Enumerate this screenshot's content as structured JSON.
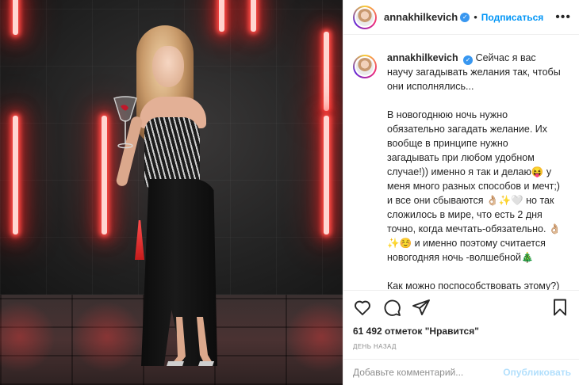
{
  "post": {
    "username": "annakhilkevich",
    "verified_icon": "verified-badge-icon",
    "separator": "•",
    "follow_label": "Подписаться",
    "more_label": "•••"
  },
  "caption": {
    "username": "annakhilkevich",
    "text": " Сейчас я вас научу загадывать желания так, чтобы они исполнялись...\n\nВ новогоднюю ночь нужно обязательно загадать желание. Их вообще в принципе нужно загадывать при любом удобном случае!)) именно я так и делаю😝 у меня много разных способов и мечт;) и все они сбываются 👌🏼✨🤍 но так сложилось в мире, что есть 2 дня точно, когда мечтать-обязательно. 👌🏼✨☺️ и именно поэтому считается новогодняя ночь -волшебной🎄\n\nКак можно поспособствовать этому?) рассказываю)) сохраняйте 😎"
  },
  "actions": {
    "like_icon": "heart-icon",
    "comment_icon": "comment-bubble-icon",
    "share_icon": "paper-plane-icon",
    "save_icon": "bookmark-icon",
    "likes_text": "61 492 отметок \"Нравится\"",
    "time_text": "ДЕНЬ НАЗАД"
  },
  "comment": {
    "placeholder": "Добавьте комментарий...",
    "publish_label": "Опубликовать"
  },
  "colors": {
    "link_blue": "#0095f6",
    "verified_blue": "#3897f0",
    "publish_disabled": "#b2dffc",
    "neon_red": "#ff4a45"
  }
}
